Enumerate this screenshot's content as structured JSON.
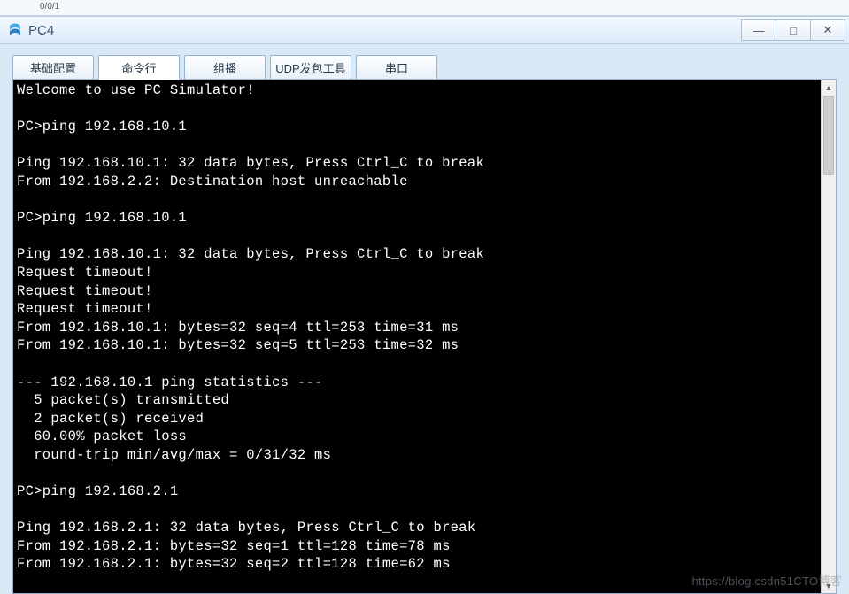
{
  "remnant_text": "0/0/1",
  "window": {
    "title": "PC4"
  },
  "tabs": [
    {
      "label": "基础配置",
      "active": false
    },
    {
      "label": "命令行",
      "active": true
    },
    {
      "label": "组播",
      "active": false
    },
    {
      "label": "UDP发包工具",
      "active": false
    },
    {
      "label": "串口",
      "active": false
    }
  ],
  "terminal_lines": [
    "Welcome to use PC Simulator!",
    "",
    "PC>ping 192.168.10.1",
    "",
    "Ping 192.168.10.1: 32 data bytes, Press Ctrl_C to break",
    "From 192.168.2.2: Destination host unreachable",
    "",
    "PC>ping 192.168.10.1",
    "",
    "Ping 192.168.10.1: 32 data bytes, Press Ctrl_C to break",
    "Request timeout!",
    "Request timeout!",
    "Request timeout!",
    "From 192.168.10.1: bytes=32 seq=4 ttl=253 time=31 ms",
    "From 192.168.10.1: bytes=32 seq=5 ttl=253 time=32 ms",
    "",
    "--- 192.168.10.1 ping statistics ---",
    "  5 packet(s) transmitted",
    "  2 packet(s) received",
    "  60.00% packet loss",
    "  round-trip min/avg/max = 0/31/32 ms",
    "",
    "PC>ping 192.168.2.1",
    "",
    "Ping 192.168.2.1: 32 data bytes, Press Ctrl_C to break",
    "From 192.168.2.1: bytes=32 seq=1 ttl=128 time=78 ms",
    "From 192.168.2.1: bytes=32 seq=2 ttl=128 time=62 ms"
  ],
  "watermark": "https://blog.csdn51CTO博客"
}
